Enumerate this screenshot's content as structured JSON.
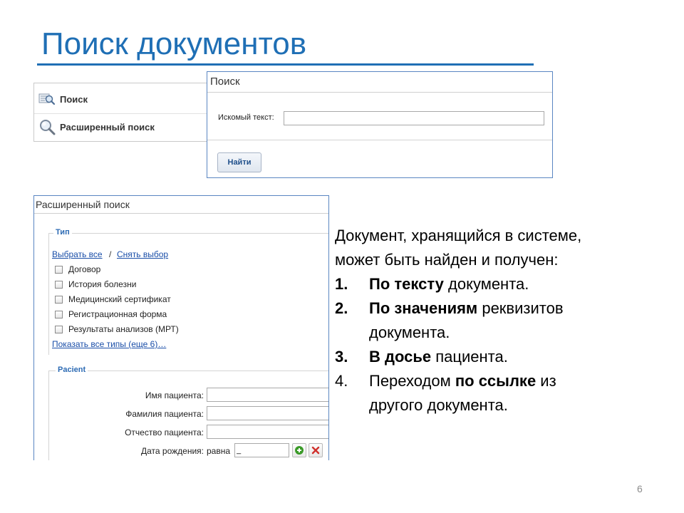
{
  "slide": {
    "title": "Поиск документов",
    "page_number": "6"
  },
  "menu": {
    "items": [
      {
        "label": "Поиск",
        "icon": "search-document-icon"
      },
      {
        "label": "Расширенный поиск",
        "icon": "magnifier-icon"
      }
    ]
  },
  "search_dialog": {
    "title": "Поиск",
    "field_label": "Искомый текст:",
    "field_value": "",
    "find_button": "Найти"
  },
  "advanced_search": {
    "title": "Расширенный поиск",
    "type_section": {
      "legend": "Тип",
      "select_all": "Выбрать все",
      "separator": "/",
      "clear_selection": "Снять выбор",
      "options": [
        {
          "label": "Договор",
          "checked": false
        },
        {
          "label": "История болезни",
          "checked": false
        },
        {
          "label": "Медицинский сертификат",
          "checked": false
        },
        {
          "label": "Регистрационная форма",
          "checked": false
        },
        {
          "label": "Результаты анализов (МРТ)",
          "checked": false
        }
      ],
      "show_all": "Показать все типы (еще 6)…"
    },
    "patient_section": {
      "legend": "Pacient",
      "fields": [
        {
          "label": "Имя пациента:",
          "value": ""
        },
        {
          "label": "Фамилия пациента:",
          "value": ""
        },
        {
          "label": "Отчество пациента:",
          "value": ""
        }
      ],
      "dob_label": "Дата рождения:",
      "dob_operator": "равна",
      "dob_value": "_"
    }
  },
  "info": {
    "intro_line1": "Документ, хранящийся в системе,",
    "intro_line2": "может быть найден и получен:",
    "list": [
      {
        "num": "1.",
        "bold": "По тексту",
        "rest": " документа."
      },
      {
        "num": "2.",
        "bold": "По значениям",
        "rest": " реквизитов",
        "line2": "документа."
      },
      {
        "num": "3.",
        "bold": "В досье",
        "rest": " пациента."
      },
      {
        "num": "4.",
        "pre": "Переходом ",
        "bold": "по ссылке",
        "rest": " из",
        "line2": "другого документа."
      }
    ]
  },
  "colors": {
    "title": "#1f6fb5",
    "panel_border": "#5a86c2",
    "link": "#1a4ea8",
    "legend": "#2d6bb4",
    "add_icon": "#3a9a28",
    "remove_icon": "#d0312d"
  }
}
